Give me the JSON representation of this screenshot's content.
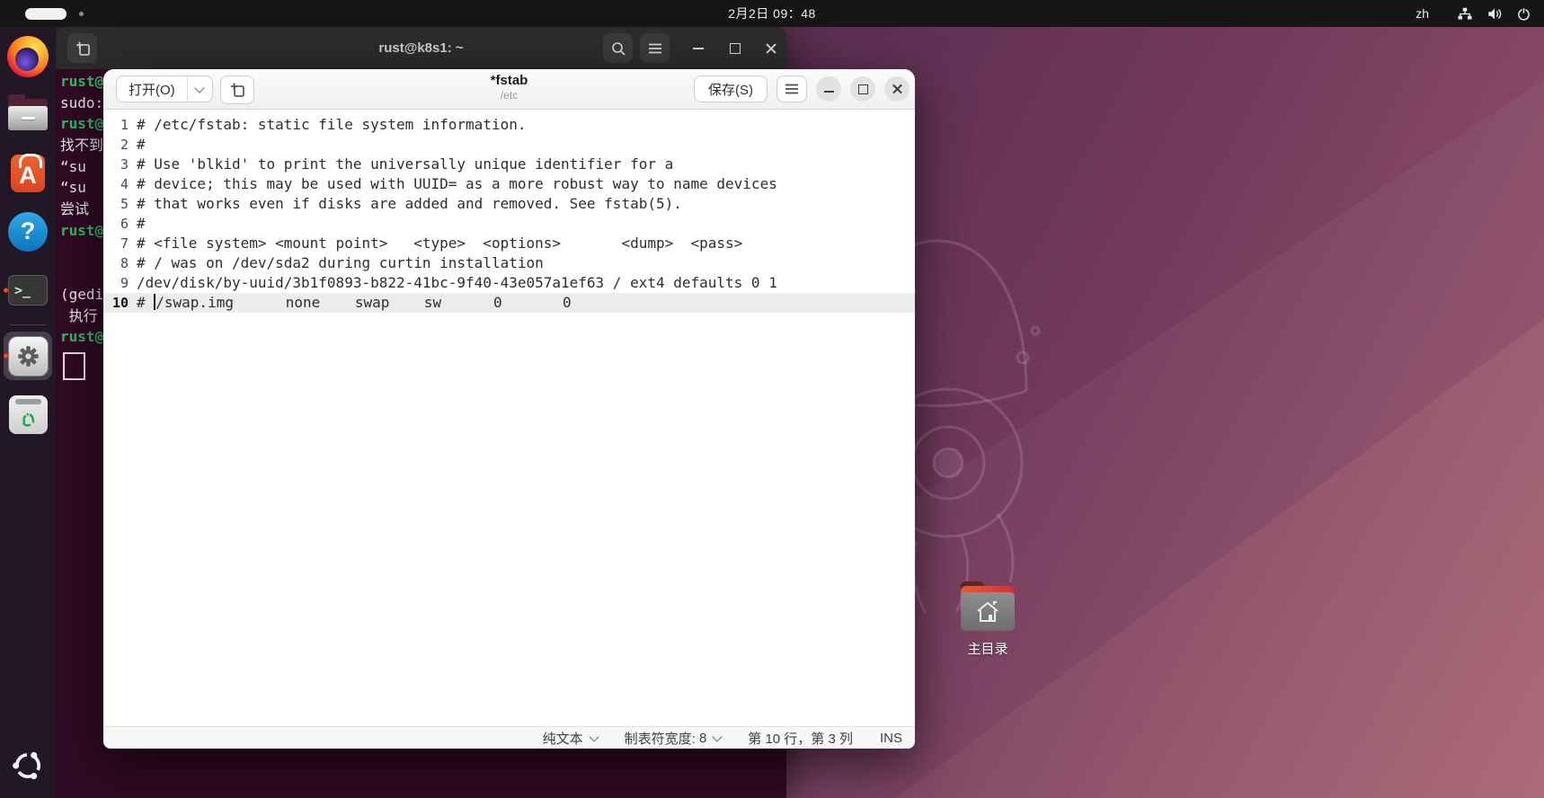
{
  "topbar": {
    "datetime": "2月2日 09：48",
    "input_method": "zh",
    "status_icons": [
      "network-icon",
      "volume-icon",
      "power-icon"
    ]
  },
  "dock": {
    "icons": [
      "firefox-icon",
      "files-icon",
      "ubuntu-software-icon",
      "help-icon",
      "terminal-icon",
      "settings-gear-icon",
      "trash-icon",
      "show-apps-icon"
    ]
  },
  "terminal": {
    "title": "rust@k8s1: ~",
    "lines": [
      {
        "text": "rust@",
        "color": "green"
      },
      {
        "text": "sudo:",
        "color": "white"
      },
      {
        "text": "rust@",
        "color": "green"
      },
      {
        "text": "找不到",
        "color": "white"
      },
      {
        "text": "“su",
        "color": "white"
      },
      {
        "text": "“su",
        "color": "white"
      },
      {
        "text": "尝试",
        "color": "white"
      },
      {
        "text": "rust@",
        "color": "green"
      },
      {
        "text": "",
        "color": "white"
      },
      {
        "text": "",
        "color": "white"
      },
      {
        "text": "(gedi",
        "color": "white"
      },
      {
        "text": " 执行",
        "color": "white"
      },
      {
        "text": "rust@",
        "color": "green"
      }
    ]
  },
  "gedit": {
    "header": {
      "open_label": "打开(O)",
      "title": "*fstab",
      "path": "/etc",
      "save_label": "保存(S)"
    },
    "lines": [
      "# /etc/fstab: static file system information.",
      "#",
      "# Use 'blkid' to print the universally unique identifier for a",
      "# device; this may be used with UUID= as a more robust way to name devices",
      "# that works even if disks are added and removed. See fstab(5).",
      "#",
      "# <file system> <mount point>   <type>  <options>       <dump>  <pass>",
      "# / was on /dev/sda2 during curtin installation",
      "/dev/disk/by-uuid/3b1f0893-b822-41bc-9f40-43e057a1ef63 / ext4 defaults 0 1",
      "# /swap.img      none    swap    sw      0       0"
    ],
    "cursor": {
      "line": 10,
      "col": 3
    },
    "statusbar": {
      "language": "纯文本",
      "tab_width_label": "制表符宽度:",
      "tab_width": "8",
      "position": "第 10 行，第 3 列",
      "mode": "INS"
    }
  },
  "desktop": {
    "home_label": "主目录"
  }
}
